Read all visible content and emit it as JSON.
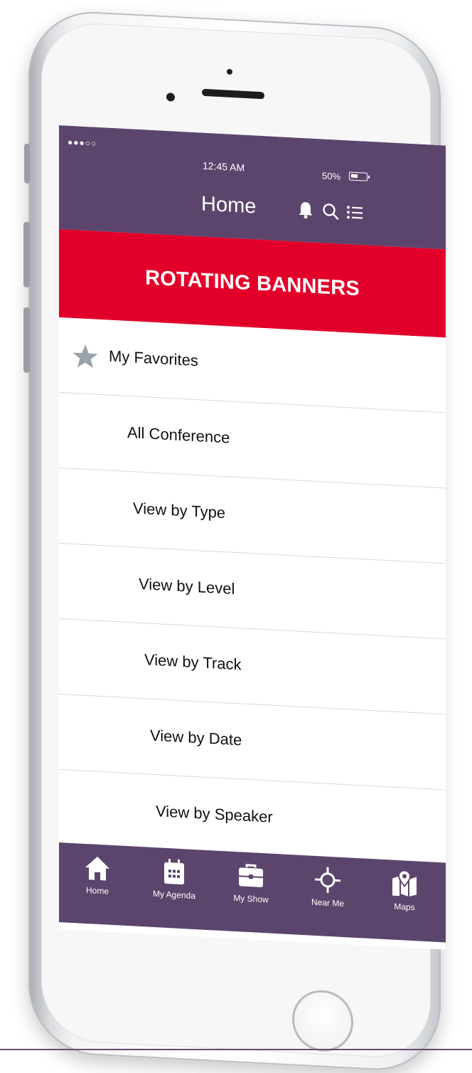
{
  "status_bar": {
    "signal": "●●●○○",
    "time": "12:45 AM",
    "battery": "50%"
  },
  "header": {
    "title": "Home",
    "icons": [
      "bell-icon",
      "search-icon",
      "menu-list-icon"
    ]
  },
  "banner": {
    "text": "ROTATING BANNERS",
    "color": "#e2002a"
  },
  "menu": {
    "items": [
      {
        "label": "My Favorites",
        "icon": "star-icon"
      },
      {
        "label": "All Conference"
      },
      {
        "label": "View by Type"
      },
      {
        "label": "View by Level"
      },
      {
        "label": "View by Track"
      },
      {
        "label": "View by Date"
      },
      {
        "label": "View by Speaker"
      }
    ]
  },
  "tabbar": {
    "tabs": [
      {
        "label": "Home",
        "icon": "home-icon"
      },
      {
        "label": "My Agenda",
        "icon": "calendar-icon"
      },
      {
        "label": "My Show",
        "icon": "briefcase-icon"
      },
      {
        "label": "Near Me",
        "icon": "crosshair-icon"
      },
      {
        "label": "Maps",
        "icon": "map-pin-icon"
      }
    ]
  },
  "colors": {
    "bar_purple": "#5c456d",
    "banner_red": "#e2002a"
  }
}
